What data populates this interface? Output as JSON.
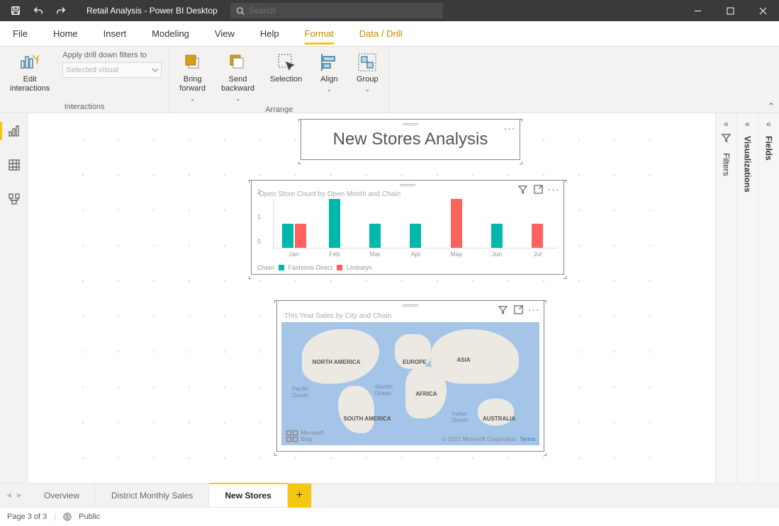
{
  "app": {
    "title": "Retail Analysis - Power BI Desktop"
  },
  "search": {
    "placeholder": "Search"
  },
  "menu": [
    "File",
    "Home",
    "Insert",
    "Modeling",
    "View",
    "Help",
    "Format",
    "Data / Drill"
  ],
  "ribbon": {
    "interactions": {
      "edit": "Edit\ninteractions",
      "drillLabel": "Apply drill down filters to",
      "drillPlaceholder": "Selected visual",
      "group": "Interactions"
    },
    "arrange": {
      "bring": "Bring\nforward",
      "send": "Send\nbackward",
      "selection": "Selection",
      "align": "Align",
      "groupBtn": "Group",
      "group": "Arrange"
    }
  },
  "panes": {
    "filters": "Filters",
    "visualizations": "Visualizations",
    "fields": "Fields"
  },
  "canvas": {
    "titleCard": "New Stores Analysis",
    "chart": {
      "title": "Open Store Count by Open Month and Chain",
      "legendPrefix": "Chain",
      "legend": [
        "Fashions Direct",
        "Lindseys"
      ]
    },
    "map": {
      "title": "This Year Sales by City and Chain",
      "continents": {
        "na": "NORTH AMERICA",
        "sa": "SOUTH AMERICA",
        "eu": "EUROPE",
        "af": "AFRICA",
        "as": "ASIA",
        "au": "AUSTRALIA"
      },
      "oceans": {
        "pac": "Pacific\nOcean",
        "atl": "Atlantic\nOcean",
        "ind": "Indian\nOcean"
      },
      "bing": "Microsoft Bing",
      "copyright": "© 2022 Microsoft Corporation",
      "terms": "Terms"
    }
  },
  "pageTabs": [
    "Overview",
    "District Monthly Sales",
    "New Stores"
  ],
  "status": {
    "page": "Page 3 of 3",
    "public": "Public"
  },
  "chart_data": {
    "type": "bar",
    "title": "Open Store Count by Open Month and Chain",
    "categories": [
      "Jan",
      "Feb",
      "Mar",
      "Apr",
      "May",
      "Jun",
      "Jul"
    ],
    "series": [
      {
        "name": "Fashions Direct",
        "values": [
          1,
          2,
          1,
          1,
          0,
          1,
          0
        ]
      },
      {
        "name": "Lindseys",
        "values": [
          1,
          0,
          0,
          0,
          2,
          0,
          1
        ]
      }
    ],
    "ylabel": "",
    "xlabel": "",
    "ylim": [
      0,
      2
    ],
    "yticks": [
      0,
      1,
      2
    ]
  }
}
